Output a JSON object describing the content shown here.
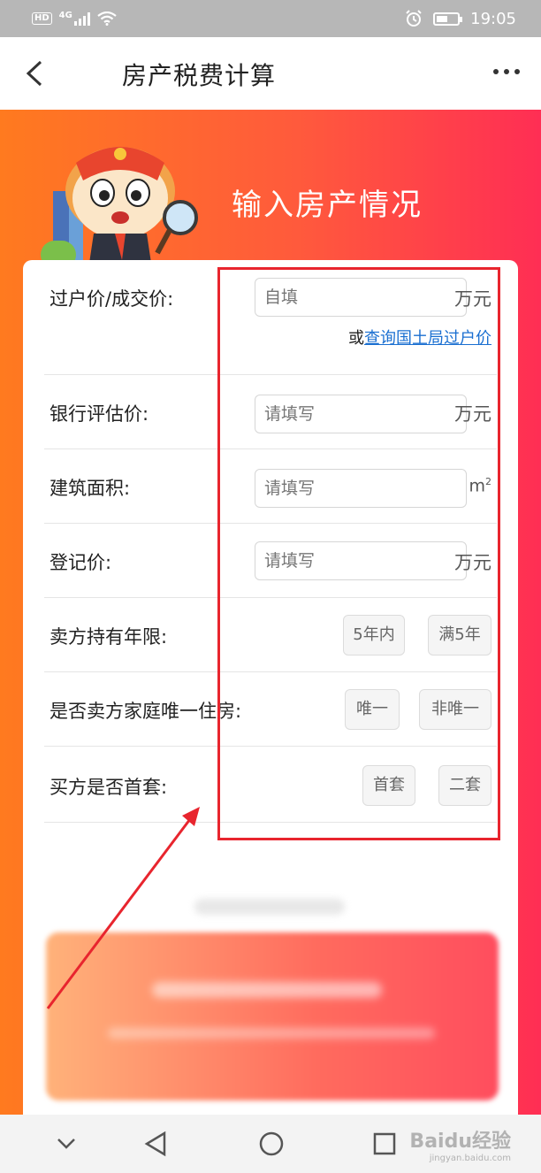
{
  "status_bar": {
    "hd": "HD",
    "network": "4G",
    "time": "19:05",
    "icons": [
      "hd-badge",
      "signal-icon",
      "wifi-icon",
      "alarm-icon",
      "battery-icon"
    ]
  },
  "nav": {
    "title": "房产税费计算",
    "back_icon": "back-arrow-icon",
    "more_icon": "more-dots-icon"
  },
  "hero": {
    "title": "输入房产情况"
  },
  "form": {
    "price": {
      "label": "过户价/成交价:",
      "placeholder": "自填",
      "unit": "万元",
      "link_prefix": "或",
      "link_text": "查询国土局过户价"
    },
    "bank_valuation": {
      "label": "银行评估价:",
      "placeholder": "请填写",
      "unit": "万元"
    },
    "area": {
      "label": "建筑面积:",
      "placeholder": "请填写",
      "unit_base": "m",
      "unit_sup": "2"
    },
    "registered_price": {
      "label": "登记价:",
      "placeholder": "请填写",
      "unit": "万元"
    },
    "holding_years": {
      "label": "卖方持有年限:",
      "options": [
        "5年内",
        "满5年"
      ]
    },
    "only_home": {
      "label": "是否卖方家庭唯一住房:",
      "options": [
        "唯一",
        "非唯一"
      ]
    },
    "first_home": {
      "label": "买方是否首套:",
      "options": [
        "首套",
        "二套"
      ]
    }
  },
  "watermark": {
    "brand": "Baidu经验",
    "url": "jingyan.baidu.com"
  },
  "colors": {
    "gradient_start": "#ff7a1f",
    "gradient_end": "#ff2e54",
    "link": "#1a6fd1",
    "annotation": "#e8252e"
  }
}
